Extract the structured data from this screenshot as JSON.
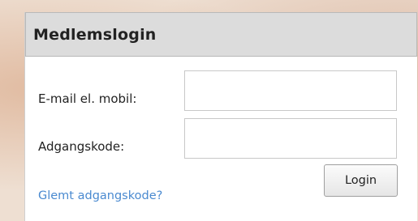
{
  "login": {
    "title": "Medlemslogin",
    "email_label": "E-mail el. mobil:",
    "email_value": "",
    "password_label": "Adgangskode:",
    "password_value": "",
    "forgot_link": "Glemt adgangskode?",
    "login_button": "Login"
  }
}
